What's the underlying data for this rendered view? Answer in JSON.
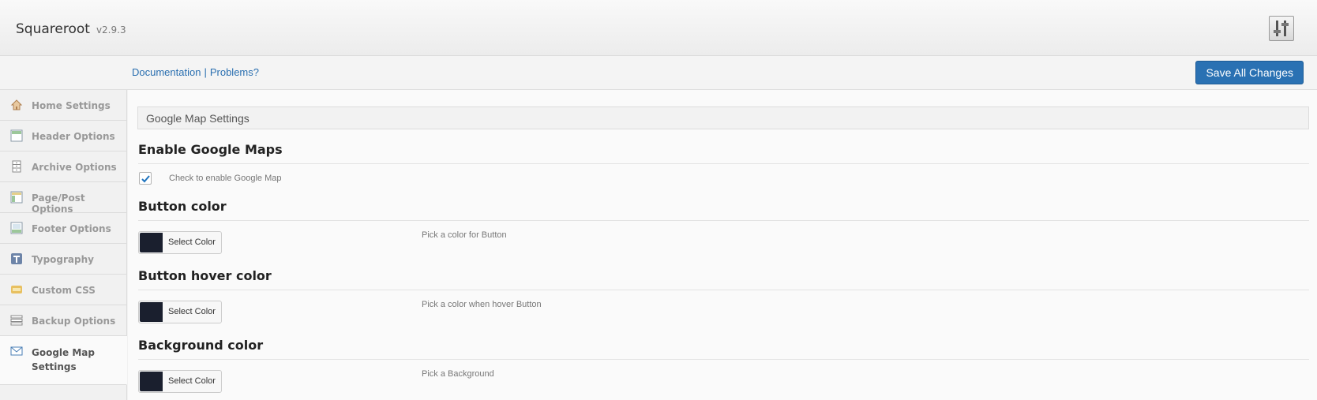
{
  "header": {
    "title": "Squareroot",
    "version": "v2.9.3",
    "logo_icon": "sliders-icon"
  },
  "toolbar": {
    "documentation": "Documentation",
    "separator": "|",
    "problems": "Problems?",
    "save_label": "Save All Changes"
  },
  "sidebar": {
    "items": [
      {
        "label": "Home Settings",
        "icon": "home-icon"
      },
      {
        "label": "Header Options",
        "icon": "header-layout-icon"
      },
      {
        "label": "Archive Options",
        "icon": "archive-icon"
      },
      {
        "label": "Page/Post Options",
        "icon": "page-layout-icon"
      },
      {
        "label": "Footer Options",
        "icon": "footer-layout-icon"
      },
      {
        "label": "Typography",
        "icon": "typography-icon"
      },
      {
        "label": "Custom CSS",
        "icon": "css-icon"
      },
      {
        "label": "Backup Options",
        "icon": "backup-icon"
      },
      {
        "label": "Google Map Settings",
        "icon": "envelope-icon"
      }
    ],
    "active_index": 8
  },
  "main": {
    "section_title": "Google Map Settings",
    "enable": {
      "heading": "Enable Google Maps",
      "checked": true,
      "label": "Check to enable Google Map"
    },
    "colors": [
      {
        "heading": "Button color",
        "button_label": "Select Color",
        "value": "#1a1f2e",
        "desc": "Pick a color for Button"
      },
      {
        "heading": "Button hover color",
        "button_label": "Select Color",
        "value": "#1a1f2e",
        "desc": "Pick a color when hover Button"
      },
      {
        "heading": "Background color",
        "button_label": "Select Color",
        "value": "#1a1f2e",
        "desc": "Pick a Background"
      }
    ]
  },
  "colors": {
    "accent": "#2a71b3",
    "link": "#2a6fb0"
  }
}
